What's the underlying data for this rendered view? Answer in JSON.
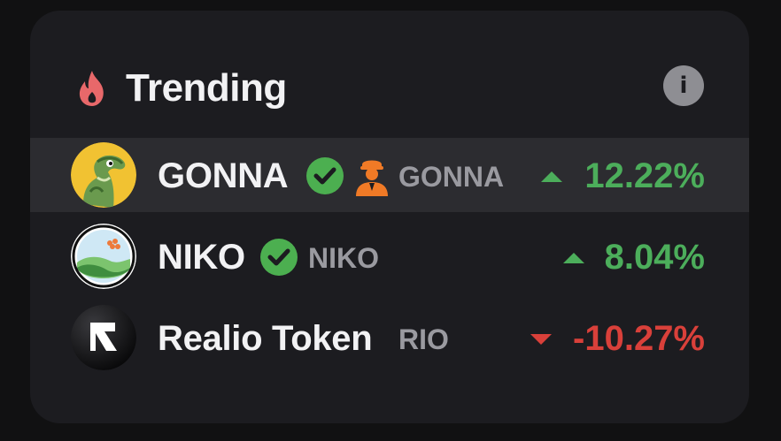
{
  "header": {
    "title": "Trending",
    "flame_icon": "flame-icon",
    "info_icon": "info-icon",
    "info_glyph": "i"
  },
  "colors": {
    "background": "#111112",
    "card": "#1c1c20",
    "highlight_row": "#2c2c30",
    "up": "#4cae5b",
    "down": "#d9403a",
    "flame": "#e8686a",
    "verified": "#4caf50",
    "person": "#f07a26"
  },
  "tokens": [
    {
      "name": "GONNA",
      "symbol": "GONNA",
      "verified": true,
      "creator_badge": "person-icon",
      "direction": "up",
      "change": "12.22%",
      "highlighted": true
    },
    {
      "name": "NIKO",
      "symbol": "NIKO",
      "verified": true,
      "direction": "up",
      "change": "8.04%",
      "highlighted": false
    },
    {
      "name": "Realio Token",
      "symbol": "RIO",
      "verified": false,
      "direction": "down",
      "change": "-10.27%",
      "highlighted": false
    }
  ]
}
